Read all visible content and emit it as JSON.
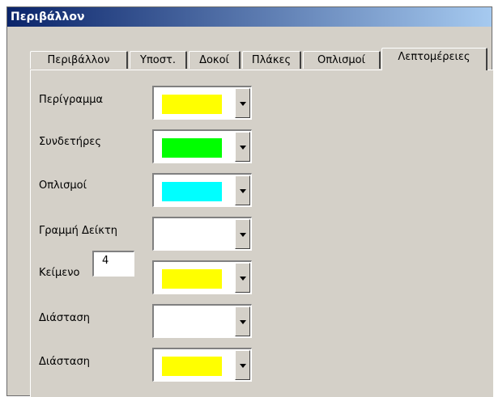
{
  "window": {
    "title": "Περιβάλλον"
  },
  "tabs": [
    {
      "label": "Περιβάλλον"
    },
    {
      "label": "Υποστ."
    },
    {
      "label": "Δοκοί"
    },
    {
      "label": "Πλάκες"
    },
    {
      "label": "Οπλισμοί"
    },
    {
      "label": "Λεπτομέρειες",
      "active": true
    }
  ],
  "rows": [
    {
      "label": "Περίγραμμα",
      "color": "#ffff00"
    },
    {
      "label": "Συνδετήρες",
      "color": "#00ff00"
    },
    {
      "label": "Οπλισμοί",
      "color": "#00ffff"
    },
    {
      "label": "Γραμμή Δείκτη",
      "color": "#ffffff"
    },
    {
      "label": "Κείμενο",
      "color": "#ffff00",
      "value": "4"
    },
    {
      "label": "Διάσταση",
      "color": "#ffffff"
    },
    {
      "label": "Διάσταση",
      "color": "#ffff00"
    }
  ]
}
